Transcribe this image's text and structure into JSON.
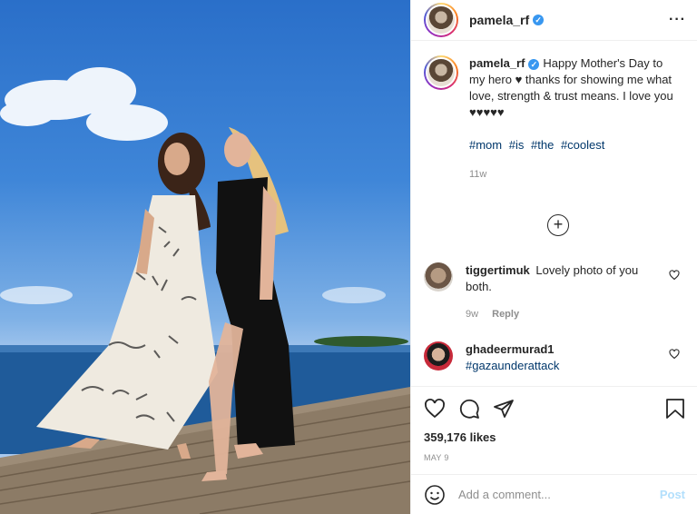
{
  "post": {
    "author": "pamela_rf",
    "verified": true,
    "more_label": "···",
    "photo_alt": "Two women standing barefoot on a wooden pier by the sea"
  },
  "caption": {
    "username": "pamela_rf",
    "text": "Happy Mother's Day to my hero ♥ thanks for showing me what love, strength & trust means. I love you ♥♥♥♥♥",
    "hashtags": [
      "#mom",
      "#is",
      "#the",
      "#coolest"
    ],
    "age": "11w"
  },
  "comments": [
    {
      "username": "tiggertimuk",
      "text": "Lovely photo of you both.",
      "age": "9w",
      "reply_label": "Reply"
    },
    {
      "username": "ghadeermurad1",
      "text": "#gazaunderattack"
    }
  ],
  "actions": {
    "likes": "359,176 likes",
    "date": "MAY 9"
  },
  "composer": {
    "placeholder": "Add a comment...",
    "post_label": "Post"
  },
  "icons": [
    "heart-icon",
    "comment-icon",
    "share-icon",
    "bookmark-icon",
    "emoji-icon",
    "plus-circle-icon",
    "more-icon",
    "verified-icon"
  ]
}
